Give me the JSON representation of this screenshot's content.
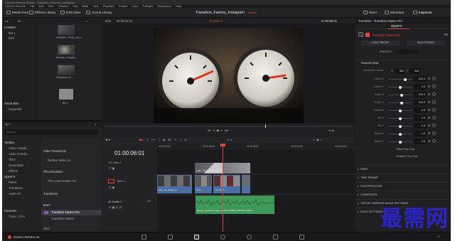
{
  "app": {
    "window_title": "DaVinci Resolve Studio - Transition_Factory_Instagram",
    "menu": [
      "DaVinci Resolve",
      "File",
      "Edit",
      "Trim",
      "Timeline",
      "Clip",
      "Mark",
      "View",
      "Playback",
      "Fusion",
      "Color",
      "Fairlight",
      "Workspace",
      "Help"
    ]
  },
  "toolbar": {
    "media_pool": "Media Pool",
    "effects_library": "Effects Library",
    "edit_index": "Edit Index",
    "sound_library": "Sound Library",
    "project_title": "Transition_Factory_Instagram",
    "edited_badge": "Edited",
    "mixer": "Mixer",
    "metadata": "Metadata",
    "inspector": "Inspector"
  },
  "viewer": {
    "zoom": "80%",
    "source_timecode": "00:00:16:16",
    "timeline_name": "Timeline 1",
    "record_timecode": "01:00:06:01"
  },
  "media_pool": {
    "bins_header": "Master",
    "bins": [
      "Bin 1",
      "Bins",
      "Effects"
    ],
    "smart_bins_header": "Smart Bins",
    "smart_bins": [
      "Keywords"
    ],
    "clips": [
      "HARDEE_TRAN_2014...",
      "Wooden_Gauges...",
      "Powershot_Fi...",
      "Bin 1"
    ]
  },
  "effects": {
    "search_placeholder": "Search",
    "tree": [
      "Toolbox",
      "Video Transiti...",
      "Audio Transiti...",
      "Titles",
      "Generators",
      "Effects",
      "OpenFX",
      "Filters",
      "Transitions",
      "Audio FX"
    ],
    "favorites_header": "Favorites",
    "favorites": [
      "Trans...l Pro"
    ],
    "categories": [
      "Video Transitions",
      "Film Emulation",
      "Transitions",
      "Blurs",
      "Transition Master Pro",
      "Transition Master",
      "Glint"
    ],
    "list_items": [
      "Reduce Noise v3",
      "Film Look Creator 3.0",
      "Transition Master Pro",
      "Transition Master"
    ]
  },
  "timeline": {
    "timecode": "01:00:06:01",
    "ruler": [
      "01:00:00:00",
      "01:00:04:00",
      "01:00:08:00",
      "01:00:12:00",
      "01:00:16:00"
    ],
    "tracks": {
      "v2": "Video 2",
      "v1": "Video 1",
      "a1": "Audio 1",
      "a1_level": "2.0"
    },
    "transition_label": "Fade - Transition Master Pro",
    "clips_v1": [
      "cam_1st_driving_2...",
      "pano...",
      "red_car_1...",
      "Dancing..."
    ],
    "audio_clip": "person_steering_in_car_engine by Wilson_Brothers_Films"
  },
  "inspector": {
    "header": "Transition - Transition Master Pro",
    "tab": "OpenFX",
    "effect_name": "Transition Master Pro",
    "load_preset": "LOAD PRESET",
    "save_preset": "SAVE PRESET",
    "presets_label": "PRESETS",
    "transform_section": "TRANSFORM",
    "transform_center_label": "Transform Center",
    "transform_center_x": "960",
    "transform_center_y": "540",
    "params": [
      {
        "label": "Offset X",
        "value": "200.0",
        "fraction": 0.72
      },
      {
        "label": "Offset Y",
        "value": "0.0",
        "fraction": 0.5
      },
      {
        "label": "Scale X",
        "value": "100.0",
        "fraction": 0.55
      },
      {
        "label": "Scale Y",
        "value": "100.0",
        "fraction": 0.55
      },
      {
        "label": "Rotation",
        "value": "0.0",
        "fraction": 0.5
      },
      {
        "label": "Tilt X",
        "value": "0.0",
        "fraction": 0.5
      },
      {
        "label": "Tilt Y",
        "value": "0.0",
        "fraction": 0.5
      },
      {
        "label": "Skew X",
        "value": "0.0",
        "fraction": 0.5
      },
      {
        "label": "Skew Y",
        "value": "0.0",
        "fraction": 0.5
      }
    ],
    "toggles": [
      "Offset Flip-Flop",
      "Rotation Flip-Flop"
    ],
    "sections": [
      "GRID",
      "TIME REMAP",
      "POSTPROCESS",
      "COMPOSITE",
      "TARGET MIRROR MODE SETTINGS",
      "EASE SETTINGS"
    ]
  },
  "status": {
    "app_label": "DaVinci Resolve 16"
  },
  "watermark": "最需网",
  "colors": {
    "accent_red": "#e0463c",
    "clip_blue": "#4a6fa5",
    "audio_green": "#3f9a5a",
    "panel_bg": "#222225"
  }
}
